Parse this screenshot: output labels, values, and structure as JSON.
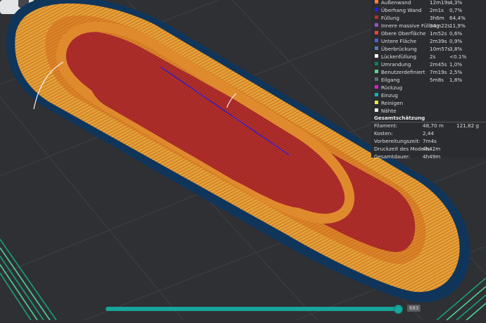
{
  "legend": {
    "items": [
      {
        "label": "Außenwand",
        "time": "12m19s",
        "percent": "4,3%",
        "color": "#ff7d38"
      },
      {
        "label": "Überhang Wand",
        "time": "2m1s",
        "percent": "0,7%",
        "color": "#1f1fff"
      },
      {
        "label": "Füllung",
        "time": "3h6m",
        "percent": "64,4%",
        "color": "#b03029"
      },
      {
        "label": "Innere massive Füllung",
        "time": "34m22s",
        "percent": "11,9%",
        "color": "#9654cc"
      },
      {
        "label": "Obere Oberfläche",
        "time": "1m52s",
        "percent": "0,6%",
        "color": "#f04040"
      },
      {
        "label": "Untere Fläche",
        "time": "2m39s",
        "percent": "0,9%",
        "color": "#4d60d5"
      },
      {
        "label": "Überbrückung",
        "time": "10m57s",
        "percent": "3,8%",
        "color": "#4d80ba"
      },
      {
        "label": "Lückenfüllung",
        "time": "2s",
        "percent": "<0.1%",
        "color": "#ffffff"
      },
      {
        "label": "Umrandung",
        "time": "2m45s",
        "percent": "1,0%",
        "color": "#00875a"
      },
      {
        "label": "Benutzerdefiniert",
        "time": "7m19s",
        "percent": "2,5%",
        "color": "#5ed194"
      },
      {
        "label": "Eilgang",
        "time": "5m8s",
        "percent": "1,8%",
        "color": "#56707f"
      },
      {
        "label": "Rückzug",
        "time": "",
        "percent": "",
        "color": "#d324d1"
      },
      {
        "label": "Einzug",
        "time": "",
        "percent": "",
        "color": "#16b5b5"
      },
      {
        "label": "Reinigen",
        "time": "",
        "percent": "",
        "color": "#e8e84a"
      },
      {
        "label": "Nähte",
        "time": "",
        "percent": "",
        "color": "#eaeaea"
      }
    ]
  },
  "summary": {
    "title": "Gesamtschätzung",
    "filament_label": "Filament:",
    "filament_length": "48,70 m",
    "filament_weight": "121,82 g",
    "cost_label": "Kosten:",
    "cost": "2,44",
    "prep_label": "Vorbereitungszeit:",
    "prep": "7m4s",
    "model_time_label": "Druckzeit des Modells:",
    "model_time": "4h42m",
    "total_label": "Gesamtdauer:",
    "total": "4h49m"
  },
  "slider": {
    "value": "683",
    "color": "#16a69a",
    "fraction": 0.984
  }
}
